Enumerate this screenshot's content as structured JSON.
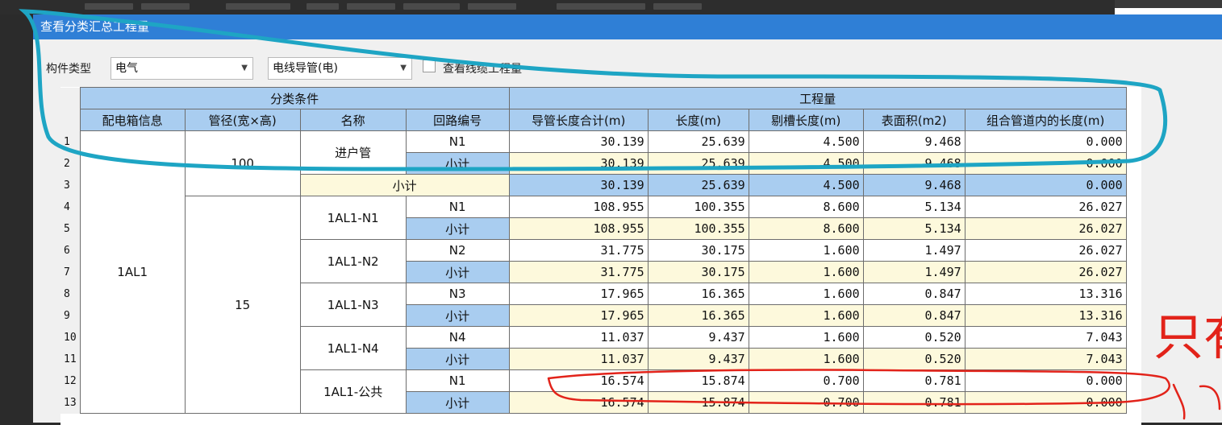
{
  "dialog": {
    "title": "查看分类汇总工程量"
  },
  "filters": {
    "component_type_label": "构件类型",
    "component_type_value": "电气",
    "sub_type_value": "电线导管(电)",
    "cable_check_label": "查看线缆工程量"
  },
  "table": {
    "group_headers": {
      "classification": "分类条件",
      "quantity": "工程量"
    },
    "columns": [
      "配电箱信息",
      "管径(宽×高)",
      "名称",
      "回路编号",
      "导管长度合计(m)",
      "长度(m)",
      "剔槽长度(m)",
      "表面积(m2)",
      "组合管道内的长度(m)"
    ],
    "row_numbers": [
      "1",
      "2",
      "3",
      "4",
      "5",
      "6",
      "7",
      "8",
      "9",
      "10",
      "11",
      "12",
      "13"
    ],
    "box_info": "1AL1",
    "diameters": [
      "100",
      "15"
    ],
    "names": [
      "进户管",
      "1AL1-N1",
      "1AL1-N2",
      "1AL1-N3",
      "1AL1-N4",
      "1AL1-公共"
    ],
    "subtotal_label": "小计",
    "rows": [
      {
        "circuit": "N1",
        "values": [
          "30.139",
          "25.639",
          "4.500",
          "9.468",
          "0.000"
        ]
      },
      {
        "circuit": "小计",
        "values": [
          "30.139",
          "25.639",
          "4.500",
          "9.468",
          "0.000"
        ]
      },
      {
        "circuit": "小计",
        "values": [
          "30.139",
          "25.639",
          "4.500",
          "9.468",
          "0.000"
        ]
      },
      {
        "circuit": "N1",
        "values": [
          "108.955",
          "100.355",
          "8.600",
          "5.134",
          "26.027"
        ]
      },
      {
        "circuit": "小计",
        "values": [
          "108.955",
          "100.355",
          "8.600",
          "5.134",
          "26.027"
        ]
      },
      {
        "circuit": "N2",
        "values": [
          "31.775",
          "30.175",
          "1.600",
          "1.497",
          "26.027"
        ]
      },
      {
        "circuit": "小计",
        "values": [
          "31.775",
          "30.175",
          "1.600",
          "1.497",
          "26.027"
        ]
      },
      {
        "circuit": "N3",
        "values": [
          "17.965",
          "16.365",
          "1.600",
          "0.847",
          "13.316"
        ]
      },
      {
        "circuit": "小计",
        "values": [
          "17.965",
          "16.365",
          "1.600",
          "0.847",
          "13.316"
        ]
      },
      {
        "circuit": "N4",
        "values": [
          "11.037",
          "9.437",
          "1.600",
          "0.520",
          "7.043"
        ]
      },
      {
        "circuit": "小计",
        "values": [
          "11.037",
          "9.437",
          "1.600",
          "0.520",
          "7.043"
        ]
      },
      {
        "circuit": "N1",
        "values": [
          "16.574",
          "15.874",
          "0.700",
          "0.781",
          "0.000"
        ]
      },
      {
        "circuit": "小计",
        "values": [
          "16.574",
          "15.874",
          "0.700",
          "0.781",
          "0.000"
        ]
      }
    ]
  },
  "annotation": {
    "handwritten_note": "只有",
    "highlight_color": "#1ea5c4",
    "mark_color": "#e2231a"
  }
}
